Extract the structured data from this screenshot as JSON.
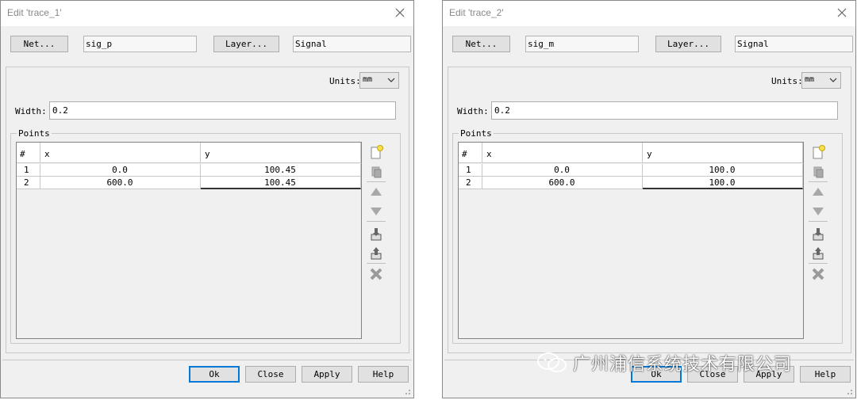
{
  "dialogs": [
    {
      "title": "Edit 'trace_1'",
      "net_button": "Net...",
      "net_value": "sig_p",
      "layer_button": "Layer...",
      "layer_value": "Signal",
      "units_label": "Units:",
      "units_value": "mm",
      "width_label": "Width:",
      "width_value": "0.2",
      "points_label": "Points",
      "columns": [
        "#",
        "x",
        "y"
      ],
      "rows": [
        {
          "num": "1",
          "x": "0.0",
          "y": "100.45"
        },
        {
          "num": "2",
          "x": "600.0",
          "y": "100.45"
        }
      ],
      "buttons": {
        "ok": "Ok",
        "close": "Close",
        "apply": "Apply",
        "help": "Help"
      }
    },
    {
      "title": "Edit 'trace_2'",
      "net_button": "Net...",
      "net_value": "sig_m",
      "layer_button": "Layer...",
      "layer_value": "Signal",
      "units_label": "Units:",
      "units_value": "mm",
      "width_label": "Width:",
      "width_value": "0.2",
      "points_label": "Points",
      "columns": [
        "#",
        "x",
        "y"
      ],
      "rows": [
        {
          "num": "1",
          "x": "0.0",
          "y": "100.0"
        },
        {
          "num": "2",
          "x": "600.0",
          "y": "100.0"
        }
      ],
      "buttons": {
        "ok": "Ok",
        "close": "Close",
        "apply": "Apply",
        "help": "Help"
      }
    }
  ],
  "toolbar_icons": [
    "new-icon",
    "copy-icon",
    "up-arrow-icon",
    "down-arrow-icon",
    "import-icon",
    "export-icon",
    "delete-icon"
  ],
  "watermark": {
    "text": "广州浦信系统技术有限公司",
    "icon": "wechat-icon"
  },
  "colors": {
    "selection": "#0078d7",
    "dialog_bg": "#f0f0f0",
    "button_bg": "#e1e1e1"
  }
}
